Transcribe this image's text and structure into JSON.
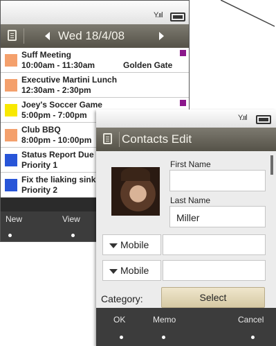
{
  "calendar": {
    "date": "Wed 18/4/08",
    "events": [
      {
        "line1": "Suff Meeting",
        "line2": "10:00am - 11:30am",
        "location": "Golden Gate",
        "color": "#f4a06c",
        "flag": true
      },
      {
        "line1": "Executive Martini Lunch",
        "line2": "12:30am - 2:30pm",
        "location": "",
        "color": "#f4a06c",
        "flag": false
      },
      {
        "line1": "Joey's Soccer Game",
        "line2": "5:00pm - 7:00pm",
        "location": "",
        "color": "#f8e800",
        "flag": true
      },
      {
        "line1": "Club BBQ",
        "line2": "8:00pm - 10:00pm",
        "location": "",
        "color": "#f4a06c",
        "flag": false
      },
      {
        "line1": "Status Report Due",
        "line2": "Priority 1",
        "location": "",
        "color": "#2855d8",
        "flag": false
      },
      {
        "line1": "Fix the liaking sink",
        "line2": "Priority 2",
        "location": "",
        "color": "#2855d8",
        "flag": false
      }
    ],
    "softkeys": {
      "left": "New",
      "middle": "View"
    }
  },
  "contacts": {
    "title": "Contacts Edit",
    "first_name_label": "First Name",
    "first_name_value": "",
    "last_name_label": "Last Name",
    "last_name_value": "Miller",
    "phone_fields": [
      {
        "type": "Mobile",
        "value": ""
      },
      {
        "type": "Mobile",
        "value": ""
      }
    ],
    "category_label": "Category:",
    "category_button": "Select",
    "softkeys": {
      "left": "OK",
      "middle": "Memo",
      "right": "Cancel"
    }
  },
  "colors": {
    "flag": "#8b168b",
    "softkey_bg": "#3c3c3c",
    "navbar": "#6a675d"
  }
}
